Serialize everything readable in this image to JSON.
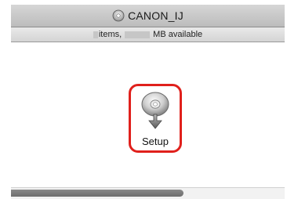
{
  "window": {
    "title": "CANON_IJ",
    "title_icon": "disk-icon"
  },
  "status": {
    "items_suffix": "items,",
    "available_suffix": "MB available"
  },
  "item": {
    "label": "Setup",
    "icon": "setup-installer-icon",
    "highlight_color": "#e0201c"
  }
}
